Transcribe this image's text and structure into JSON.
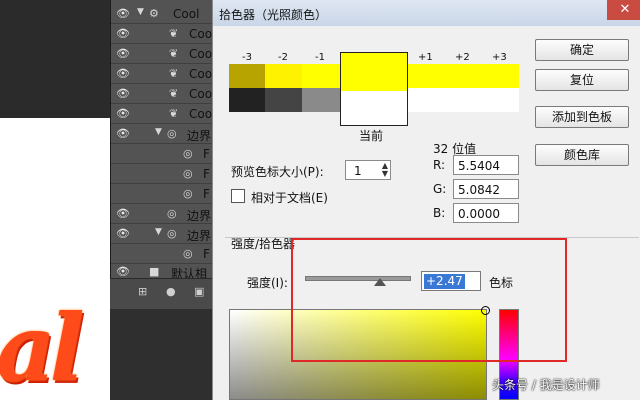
{
  "layers_panel": {
    "rows": [
      {
        "label": "Cool"
      },
      {
        "label": "Cool"
      },
      {
        "label": "Cool"
      },
      {
        "label": "Cool"
      },
      {
        "label": "Cool"
      },
      {
        "label": "Cool"
      },
      {
        "label": "边界"
      },
      {
        "label": "F"
      },
      {
        "label": "F"
      },
      {
        "label": "F"
      },
      {
        "label": "边界"
      },
      {
        "label": "边界"
      },
      {
        "label": "F"
      },
      {
        "label": "默认相"
      }
    ]
  },
  "canvas": {
    "text": "al",
    "text_color": "#ff4a1a"
  },
  "dialog": {
    "title": "拾色器（光照颜色）",
    "close_icon": "close-icon",
    "stops": {
      "labels": [
        "-3",
        "-2",
        "-1",
        "+1",
        "+2",
        "+3"
      ],
      "current_label": "当前"
    },
    "buttons": {
      "ok": "确定",
      "reset": "复位",
      "add_to_swatches": "添加到色板",
      "color_library": "颜色库"
    },
    "preview_size": {
      "label": "预览色标大小(P):",
      "value": "1"
    },
    "relative_to_document": {
      "label": "相对于文档(E)",
      "checked": false
    },
    "values_header": "32 位值",
    "r": {
      "label": "R:",
      "value": "5.5404"
    },
    "g": {
      "label": "G:",
      "value": "5.0842"
    },
    "b": {
      "label": "B:",
      "value": "0.0000"
    },
    "section_title": "强度/拾色器",
    "intensity": {
      "label": "强度(I):",
      "value": "+2.47",
      "unit": "色标",
      "slider_level": 0.72
    },
    "accent_color": "#ffff00"
  },
  "watermark": "头条号 / 我是设计师",
  "highlight_color": "#e02828"
}
